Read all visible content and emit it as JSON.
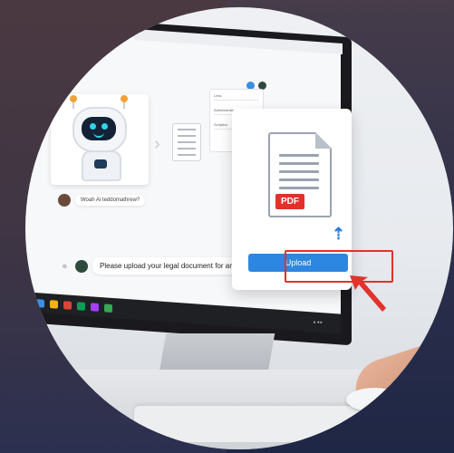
{
  "chat": {
    "small_bubble": "Woah Ai teddomathrew?",
    "main_bubble": "Please upload your legal document for analysis"
  },
  "side_form": {
    "fields": [
      "Less",
      "Administrate",
      "Scriptive"
    ]
  },
  "upload_card": {
    "file_type": "PDF",
    "button_label": "Upload"
  },
  "colors": {
    "accent": "#2d86e0",
    "pdf_red": "#e3302b",
    "highlight_red": "#e2322c"
  },
  "icons": [
    "robot-icon",
    "document-icon",
    "chevron-right-icon",
    "upload-arrow-icon",
    "user-icon",
    "pdf-icon"
  ]
}
